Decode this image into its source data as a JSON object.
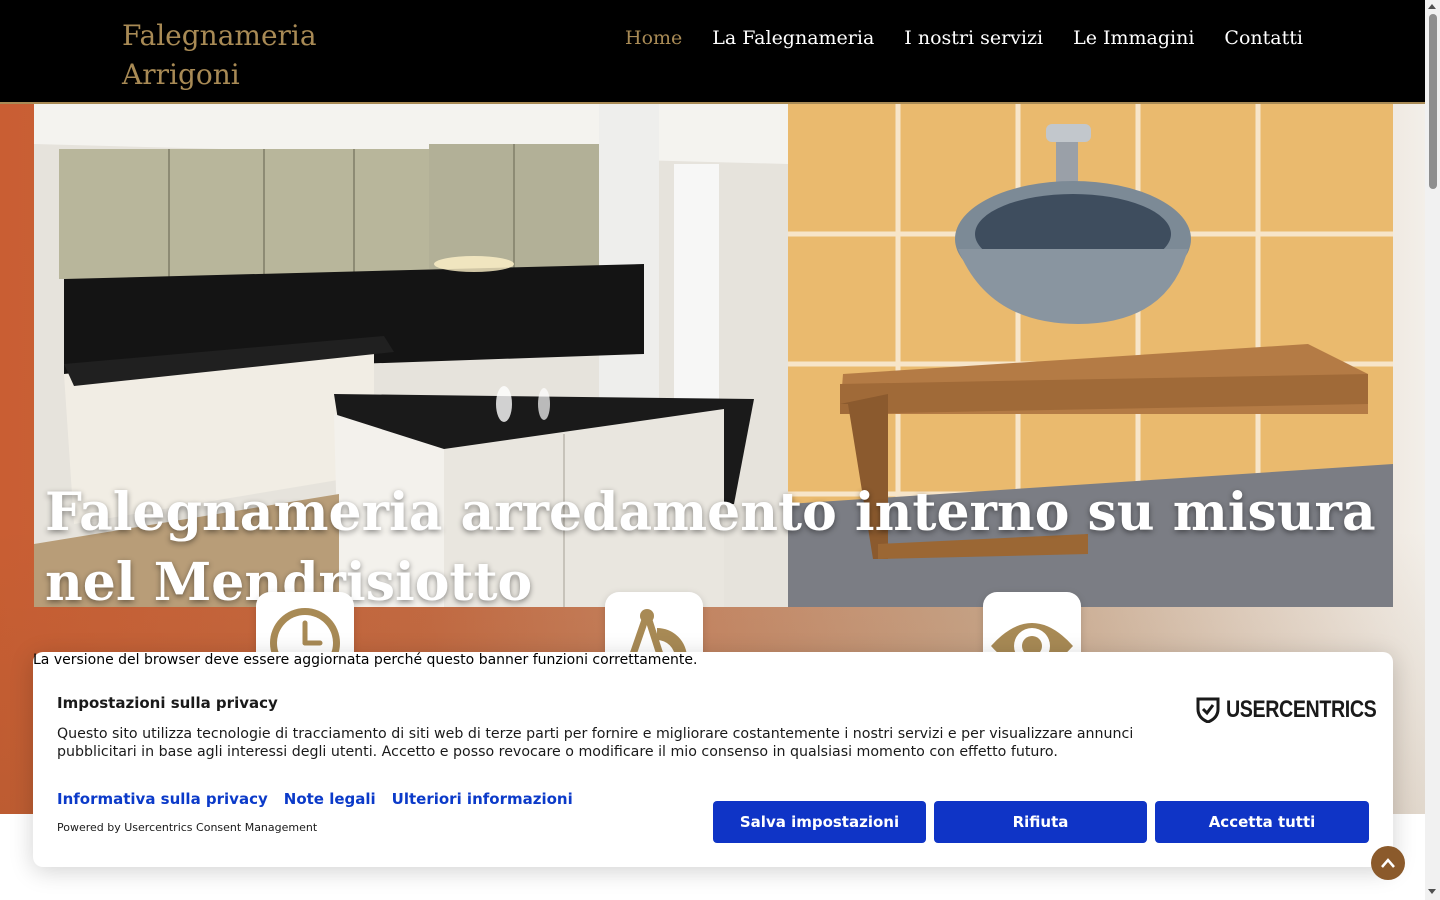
{
  "header": {
    "logo_line1": "Falegnameria",
    "logo_line2": "Arrigoni",
    "nav": [
      {
        "label": "Home",
        "active": true
      },
      {
        "label": "La Falegnameria"
      },
      {
        "label": "I nostri servizi"
      },
      {
        "label": "Le Immagini"
      },
      {
        "label": "Contatti"
      }
    ]
  },
  "hero": {
    "title_line1": "Falegnameria arredamento interno su misura",
    "title_line2": "nel Mendrisiotto",
    "features": [
      {
        "icon": "clock-icon"
      },
      {
        "icon": "compass-ruler-icon"
      },
      {
        "icon": "eye-icon"
      }
    ]
  },
  "consent": {
    "browser_warning": "La versione del browser deve essere aggiornata perché questo banner funzioni correttamente.",
    "title": "Impostazioni sulla privacy",
    "body": "Questo sito utilizza tecnologie di tracciamento di siti web di terze parti per fornire e migliorare costantemente i nostri servizi e per visualizzare annunci pubblicitari in base agli interessi degli utenti. Accetto e posso revocare o modificare il mio consenso in qualsiasi momento con effetto futuro.",
    "brand": "USERCENTRICS",
    "links": {
      "privacy": "Informativa sulla privacy",
      "legal": "Note legali",
      "more": "Ulteriori informazioni"
    },
    "powered_by": "Powered by Usercentrics Consent Management",
    "buttons": {
      "save": "Salva impostazioni",
      "deny": "Rifiuta",
      "accept": "Accetta tutti"
    }
  },
  "colors": {
    "accent_gold": "#a88a55",
    "button_blue": "#0f34c6",
    "link_blue": "#0b3ac9",
    "header_bg": "#000000"
  }
}
